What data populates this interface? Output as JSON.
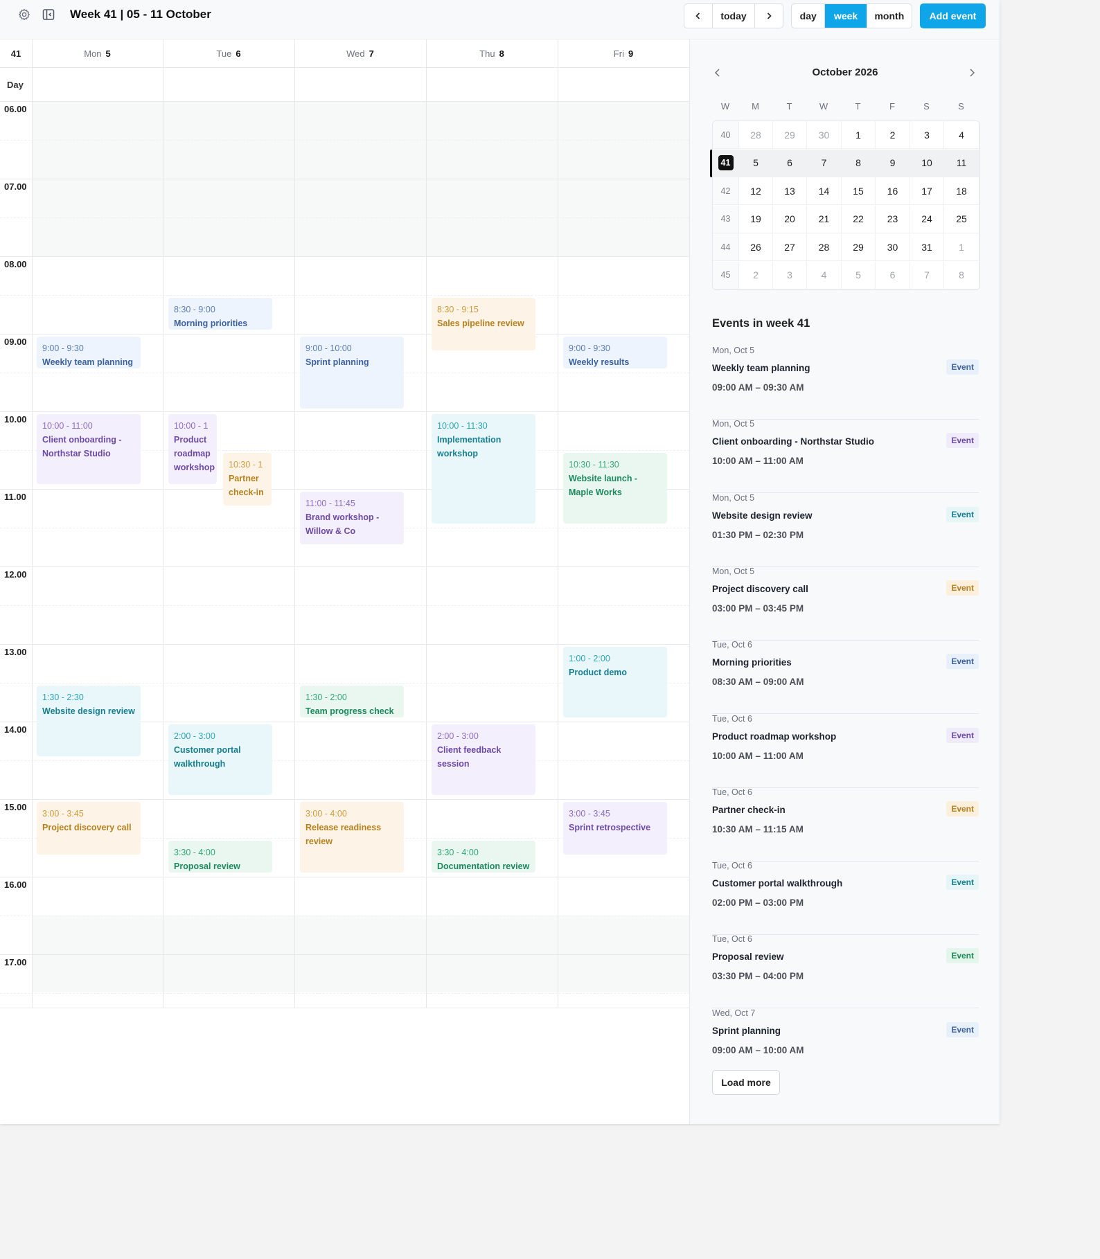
{
  "header": {
    "title": "Week 41 | 05 - 11 October",
    "nav": {
      "today": "today"
    },
    "views": [
      "day",
      "week",
      "month"
    ],
    "active_view": "week",
    "add_event": "Add event",
    "accent": "#0ea5e9"
  },
  "grid": {
    "week_number": "41",
    "allday_label": "Day",
    "days": [
      {
        "name": "Mon",
        "num": "5"
      },
      {
        "name": "Tue",
        "num": "6"
      },
      {
        "name": "Wed",
        "num": "7"
      },
      {
        "name": "Thu",
        "num": "8"
      },
      {
        "name": "Fri",
        "num": "9"
      }
    ],
    "hours": [
      "06.00",
      "07.00",
      "08.00",
      "09.00",
      "10.00",
      "11.00",
      "12.00",
      "13.00",
      "14.00",
      "15.00",
      "16.00",
      "17.00"
    ],
    "events": [
      {
        "day": 1,
        "time": "8:30 - 9:00",
        "title": "Morning priorities",
        "color": "blue"
      },
      {
        "day": 3,
        "time": "8:30 - 9:15",
        "title": "Sales pipeline review",
        "color": "orange"
      },
      {
        "day": 0,
        "time": "9:00 - 9:30",
        "title": "Weekly team planning",
        "color": "blue"
      },
      {
        "day": 2,
        "time": "9:00 - 10:00",
        "title": "Sprint planning",
        "color": "blue"
      },
      {
        "day": 4,
        "time": "9:00 - 9:30",
        "title": "Weekly results",
        "color": "blue"
      },
      {
        "day": 0,
        "time": "10:00 - 11:00",
        "title": "Client onboarding - Northstar Studio",
        "color": "purple"
      },
      {
        "day": 1,
        "time": "10:00 - 1",
        "title": "Product roadmap workshop",
        "color": "purple"
      },
      {
        "day": 1,
        "time": "10:30 - 1",
        "title": "Partner check-in",
        "color": "orange"
      },
      {
        "day": 3,
        "time": "10:00 - 11:30",
        "title": "Implementation workshop",
        "color": "teal"
      },
      {
        "day": 4,
        "time": "10:30 - 11:30",
        "title": "Website launch - Maple Works",
        "color": "green"
      },
      {
        "day": 2,
        "time": "11:00 - 11:45",
        "title": "Brand workshop - Willow & Co",
        "color": "purple"
      },
      {
        "day": 4,
        "time": "1:00 - 2:00",
        "title": "Product demo",
        "color": "teal"
      },
      {
        "day": 0,
        "time": "1:30 - 2:30",
        "title": "Website design review",
        "color": "teal"
      },
      {
        "day": 2,
        "time": "1:30 - 2:00",
        "title": "Team progress check",
        "color": "green"
      },
      {
        "day": 1,
        "time": "2:00 - 3:00",
        "title": "Customer portal walkthrough",
        "color": "teal"
      },
      {
        "day": 3,
        "time": "2:00 - 3:00",
        "title": "Client feedback session",
        "color": "purple"
      },
      {
        "day": 0,
        "time": "3:00 - 3:45",
        "title": "Project discovery call",
        "color": "orange"
      },
      {
        "day": 2,
        "time": "3:00 - 4:00",
        "title": "Release readiness review",
        "color": "orange"
      },
      {
        "day": 4,
        "time": "3:00 - 3:45",
        "title": "Sprint retrospective",
        "color": "purple"
      },
      {
        "day": 1,
        "time": "3:30 - 4:00",
        "title": "Proposal review",
        "color": "green"
      },
      {
        "day": 3,
        "time": "3:30 - 4:00",
        "title": "Documentation review",
        "color": "green"
      }
    ]
  },
  "mini_calendar": {
    "title": "October 2026",
    "headers": [
      "W",
      "M",
      "T",
      "W",
      "T",
      "F",
      "S",
      "S"
    ],
    "rows": [
      {
        "week": "40",
        "days": [
          "28",
          "29",
          "30",
          "1",
          "2",
          "3",
          "4"
        ],
        "muted": [
          0,
          1,
          2
        ]
      },
      {
        "week": "41",
        "days": [
          "5",
          "6",
          "7",
          "8",
          "9",
          "10",
          "11"
        ],
        "muted": [],
        "selected": true
      },
      {
        "week": "42",
        "days": [
          "12",
          "13",
          "14",
          "15",
          "16",
          "17",
          "18"
        ],
        "muted": []
      },
      {
        "week": "43",
        "days": [
          "19",
          "20",
          "21",
          "22",
          "23",
          "24",
          "25"
        ],
        "muted": []
      },
      {
        "week": "44",
        "days": [
          "26",
          "27",
          "28",
          "29",
          "30",
          "31",
          "1"
        ],
        "muted": [
          6
        ]
      },
      {
        "week": "45",
        "days": [
          "2",
          "3",
          "4",
          "5",
          "6",
          "7",
          "8"
        ],
        "muted": [
          0,
          1,
          2,
          3,
          4,
          5,
          6
        ]
      }
    ]
  },
  "event_list": {
    "title": "Events in week 41",
    "items": [
      {
        "date": "Mon, Oct 5",
        "name": "Weekly team planning",
        "time": "09:00 AM – 09:30 AM",
        "badge": "Event",
        "color": "blue"
      },
      {
        "date": "Mon, Oct 5",
        "name": "Client onboarding - Northstar Studio",
        "time": "10:00 AM – 11:00 AM",
        "badge": "Event",
        "color": "purple"
      },
      {
        "date": "Mon, Oct 5",
        "name": "Website design review",
        "time": "01:30 PM – 02:30 PM",
        "badge": "Event",
        "color": "teal"
      },
      {
        "date": "Mon, Oct 5",
        "name": "Project discovery call",
        "time": "03:00 PM – 03:45 PM",
        "badge": "Event",
        "color": "orange"
      },
      {
        "date": "Tue, Oct 6",
        "name": "Morning priorities",
        "time": "08:30 AM – 09:00 AM",
        "badge": "Event",
        "color": "blue"
      },
      {
        "date": "Tue, Oct 6",
        "name": "Product roadmap workshop",
        "time": "10:00 AM – 11:00 AM",
        "badge": "Event",
        "color": "purple"
      },
      {
        "date": "Tue, Oct 6",
        "name": "Partner check-in",
        "time": "10:30 AM – 11:15 AM",
        "badge": "Event",
        "color": "orange"
      },
      {
        "date": "Tue, Oct 6",
        "name": "Customer portal walkthrough",
        "time": "02:00 PM – 03:00 PM",
        "badge": "Event",
        "color": "teal"
      },
      {
        "date": "Tue, Oct 6",
        "name": "Proposal review",
        "time": "03:30 PM – 04:00 PM",
        "badge": "Event",
        "color": "green"
      },
      {
        "date": "Wed, Oct 7",
        "name": "Sprint planning",
        "time": "09:00 AM – 10:00 AM",
        "badge": "Event",
        "color": "blue"
      }
    ],
    "load_more": "Load more"
  },
  "icons": {
    "settings": "gear-icon",
    "sidebar_toggle": "sidebar-toggle-icon",
    "prev": "chevron-left-icon",
    "next": "chevron-right-icon"
  }
}
